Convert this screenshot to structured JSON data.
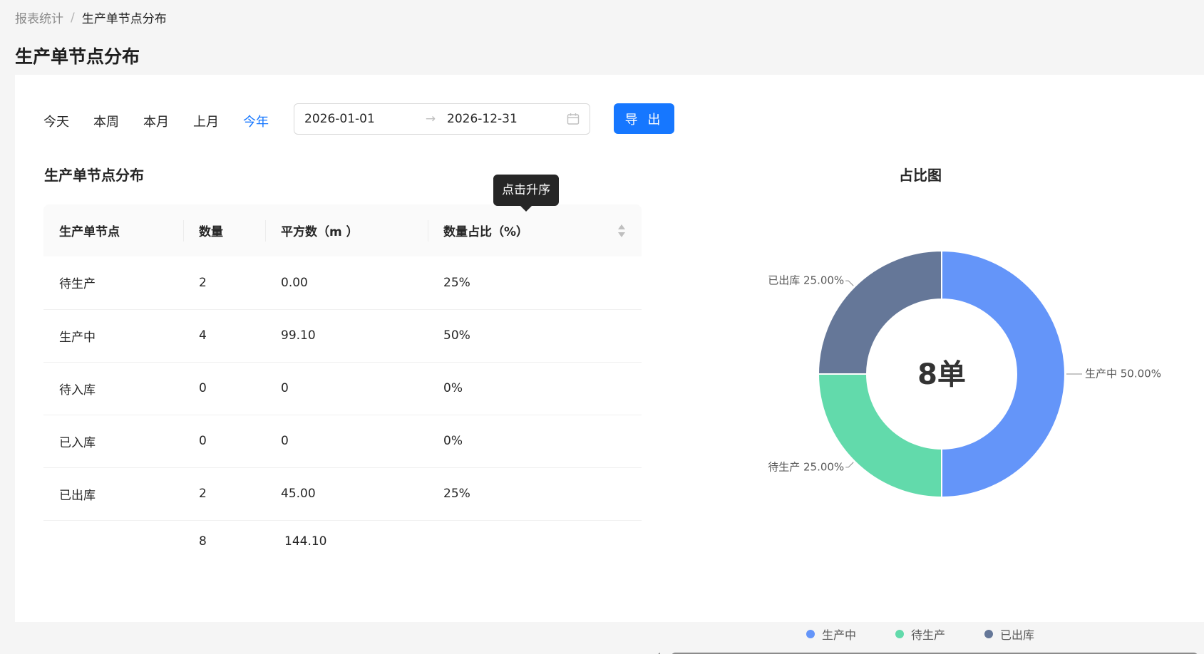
{
  "breadcrumb": {
    "parent": "报表统计",
    "separator": "/",
    "current": "生产单节点分布"
  },
  "page_title": "生产单节点分布",
  "filters": {
    "quick": [
      {
        "label": "今天",
        "active": false
      },
      {
        "label": "本周",
        "active": false
      },
      {
        "label": "本月",
        "active": false
      },
      {
        "label": "上月",
        "active": false
      },
      {
        "label": "今年",
        "active": true
      }
    ],
    "range": {
      "start": "2026-01-01",
      "arrow": "→",
      "end": "2026-12-31"
    },
    "export_label": "导 出"
  },
  "table": {
    "title": "生产单节点分布",
    "tooltip": "点击升序",
    "columns": [
      "生产单节点",
      "数量",
      "平方数（m ）",
      "数量占比（%）"
    ],
    "rows": [
      [
        "待生产",
        "2",
        "0.00",
        "25%"
      ],
      [
        "生产中",
        "4",
        "99.10",
        "50%"
      ],
      [
        "待入库",
        "0",
        "0",
        "0%"
      ],
      [
        "已入库",
        "0",
        "0",
        "0%"
      ],
      [
        "已出库",
        "2",
        "45.00",
        "25%"
      ]
    ],
    "summary": {
      "count": "8",
      "area": "144.10"
    }
  },
  "chart_data": {
    "type": "pie",
    "title": "占比图",
    "center_label": "8单",
    "slices": [
      {
        "name": "生产中",
        "value": 50.0,
        "label": "生产中 50.00%",
        "color": "#6495f9"
      },
      {
        "name": "待生产",
        "value": 25.0,
        "label": "待生产 25.00%",
        "color": "#62daab"
      },
      {
        "name": "已出库",
        "value": 25.0,
        "label": "已出库 25.00%",
        "color": "#657798"
      }
    ],
    "legend": [
      "生产中",
      "待生产",
      "已出库"
    ],
    "legend_placement": "bottom"
  },
  "colors": {
    "primary": "#1677ff",
    "text": "#262626",
    "muted": "#8c8c8c"
  }
}
